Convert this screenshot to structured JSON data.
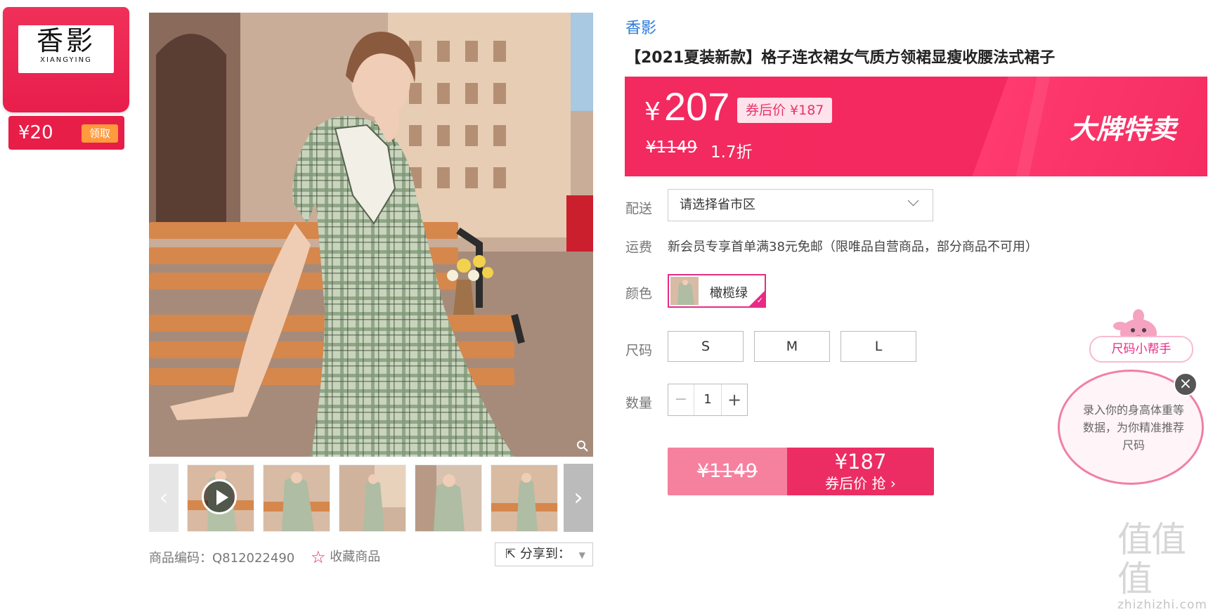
{
  "brand_card": {
    "logo_cn": "香影",
    "logo_en": "XIANGYING",
    "coupon_amount": "¥20",
    "coupon_action": "领取"
  },
  "gallery": {
    "prev_arrow": "‹",
    "next_arrow": "›",
    "product_code": "商品编码：Q812022490",
    "favorite": "收藏商品",
    "share": "分享到：",
    "thumbnail_count": 5
  },
  "product": {
    "brand": "香影",
    "title": "【2021夏装新款】格子连衣裙女气质方领裙显瘦收腰法式裙子"
  },
  "price": {
    "currency": "¥",
    "current": "207",
    "after_coupon": "券后价 ¥187",
    "original": "¥1149",
    "discount": "1.7折",
    "promo_tag": "大牌特卖"
  },
  "options": {
    "delivery_label": "配送",
    "delivery_placeholder": "请选择省市区",
    "shipping_label": "运费",
    "shipping_text": "新会员专享首单满38元免邮（限唯品自营商品，部分商品不可用）",
    "color_label": "颜色",
    "color_selected": "橄榄绿",
    "size_label": "尺码",
    "sizes": [
      "S",
      "M",
      "L"
    ],
    "quantity_label": "数量",
    "quantity": "1",
    "minus": "−",
    "plus": "+"
  },
  "buy": {
    "original": "¥1149",
    "price": "¥187",
    "action": "券后价 抢 ›"
  },
  "size_helper": {
    "title": "尺码小帮手",
    "text": "录入你的身高体重等数据，为你精准推荐尺码",
    "close": "×"
  },
  "watermark": {
    "big": "值值值",
    "small": "zhizhizhi.com"
  },
  "colors": {
    "accent": "#f32a5f",
    "brand_link": "#2c7cd8",
    "selection": "#e82b84",
    "coupon_badge": "#ff9a3d"
  }
}
